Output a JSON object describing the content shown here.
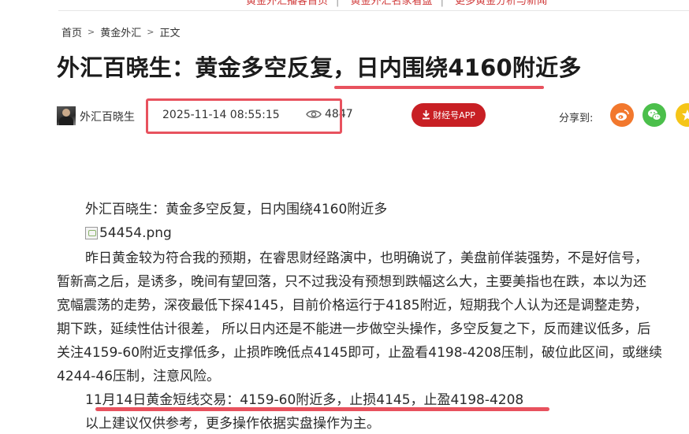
{
  "top_links": [
    "黄金外汇播客首页",
    "黄金外汇名家看盘",
    "更多黄金分析与新闻"
  ],
  "breadcrumb": [
    "首页",
    "黄金外汇",
    "正文"
  ],
  "article": {
    "title": "外汇百晓生：黄金多空反复，日内围绕4160附近多",
    "author": "外汇百晓生",
    "datetime": "2025-11-14 08:55:15",
    "views": "4847",
    "app_button": "财经号APP",
    "share_label": "分享到:",
    "share_icons": [
      "weibo-icon",
      "wechat-icon",
      "star-icon"
    ],
    "paragraphs": [
      "外汇百晓生：黄金多空反复，日内围绕4160附近多",
      "54454.png",
      "昨日黄金较为符合我的预期，在睿思财经路演中，也明确说了，美盘前佯装强势，不是好信号，",
      "暂新高之后，是诱多，晚间有望回落，只不过我没有预想到跌幅这么大，主要美指也在跌，本以为还",
      "宽幅震荡的走势，深夜最低下探4145，目前价格运行于4185附近，短期我个人认为还是调整走势，",
      "期下跌，延续性估计很差， 所以日内还是不能进一步做空头操作，多空反复之下，反而建议低多，后",
      "关注4159-60附近支撑低多，止损昨晚低点4145即可，止盈看4198-4208压制，破位此区间，或继续",
      "4244-46压制，注意风险。",
      "11月14日黄金短线交易：4159-60附近多，止损4145，止盈4198-4208",
      "以上建议仅供参考，更多操作依据实盘操作为主。"
    ]
  },
  "colors": {
    "annotation_red": "#e8525e",
    "app_button_bg": "#c81f24",
    "weibo": "#f2782d",
    "wechat": "#4bbf4b",
    "star": "#f5c518"
  }
}
